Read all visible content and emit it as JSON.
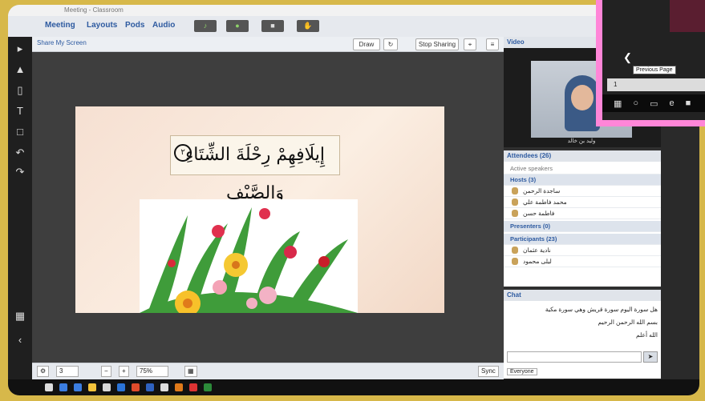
{
  "window": {
    "title": "Meeting - Classroom"
  },
  "menu": [
    "Meeting",
    "Layouts",
    "Pods",
    "Audio"
  ],
  "share": {
    "title": "Share My Screen",
    "draw_label": "Draw",
    "stop_label": "Stop Sharing"
  },
  "slide": {
    "verse": "إِيلَافِهِمْ رِحْلَةَ الشِّتَاءِ وَالصَّيْفِ",
    "verse_num": "٢"
  },
  "video": {
    "header": "Video",
    "caption": "وليد بن خالد"
  },
  "attendees": {
    "header": "Attendees (26)",
    "search": "Active speakers",
    "hosts_header": "Hosts (3)",
    "hosts": [
      "ساجدة الرحمن",
      "محمد فاطمة علي",
      "فاطمة حسن"
    ],
    "presenters_header": "Presenters (0)",
    "participants_header": "Participants (23)",
    "participants": [
      "نادية عثمان",
      "ليلى محمود"
    ]
  },
  "chat": {
    "header": "Chat",
    "tab": "Everyone",
    "messages": [
      "هل سورة اليوم سورة قريش وهي سورة مكية",
      "بسم الله الرحمن الرحيم",
      "الله أعلم"
    ],
    "send_label": "Everyone"
  },
  "bottom": {
    "page": "3",
    "zoom": "75%",
    "sync": "Sync"
  },
  "overlay": {
    "tooltip": "Previous Page",
    "page_num": "1"
  }
}
